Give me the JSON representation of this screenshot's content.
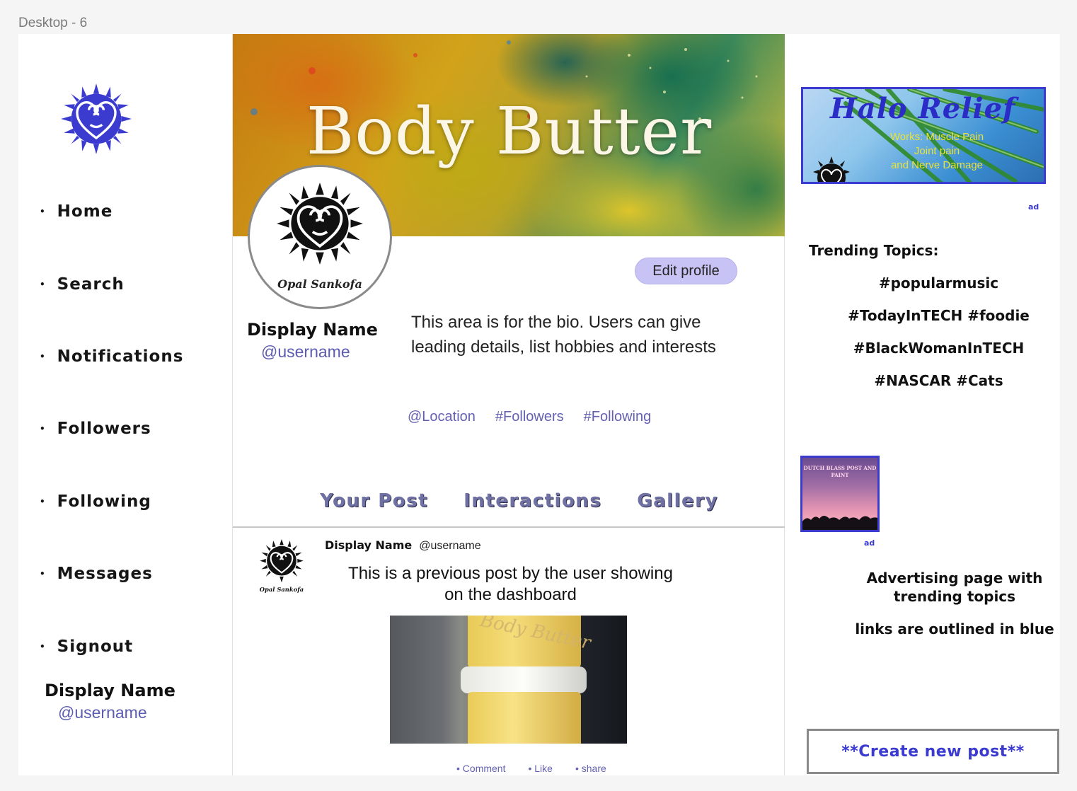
{
  "frame": {
    "label": "Desktop - 6"
  },
  "sidebar": {
    "items": [
      {
        "label": "Home"
      },
      {
        "label": "Search"
      },
      {
        "label": "Notifications"
      },
      {
        "label": "Followers"
      },
      {
        "label": "Following"
      },
      {
        "label": "Messages"
      },
      {
        "label": "Signout"
      }
    ],
    "display_name": "Display Name",
    "username": "@username"
  },
  "profile": {
    "banner_title": "Body Butter",
    "avatar_caption": "Opal Sankofa",
    "edit_label": "Edit profile",
    "display_name": "Display Name",
    "username": "@username",
    "bio": "This area is for the bio. Users can give leading details, list hobbies and interests",
    "meta": {
      "location": "@Location",
      "followers": "#Followers",
      "following": "#Following"
    }
  },
  "tabs": [
    {
      "label": "Your Post"
    },
    {
      "label": "Interactions"
    },
    {
      "label": "Gallery"
    }
  ],
  "post": {
    "logo_caption": "Opal Sankofa",
    "display_name": "Display Name",
    "username": "@username",
    "text": "This is a previous post by the user showing on the dashboard",
    "photo_label": "Body Butter",
    "actions": {
      "comment": "• Comment",
      "like": "• Like",
      "share": "• share"
    }
  },
  "right": {
    "ad1": {
      "title": "Halo Relief",
      "line1": "Works: Muscle Pain",
      "line2": "Joint pain",
      "line3": "and Nerve Damage",
      "tag": "ad"
    },
    "trending_title": "Trending Topics:",
    "trending": [
      "#popularmusic",
      "#TodayInTECH #foodie",
      "#BlackWomanInTECH",
      "#NASCAR #Cats"
    ],
    "ad2": {
      "text": "DUTCH BLASS POST AND PAINT",
      "tag": "ad"
    },
    "note1": "Advertising page with trending topics",
    "note2": "links are outlined in blue",
    "create_label": "**Create new post**"
  },
  "colors": {
    "accent_blue": "#3b3bd0",
    "link_purple": "#6461b2",
    "edit_button": "#c8c3f5",
    "tab_text": "#6f70a3"
  },
  "icons": {
    "brand_logo_blue": "sankofa-sun-heart-icon",
    "avatar_logo": "sankofa-sun-heart-icon",
    "post_logo": "sankofa-sun-heart-icon"
  }
}
